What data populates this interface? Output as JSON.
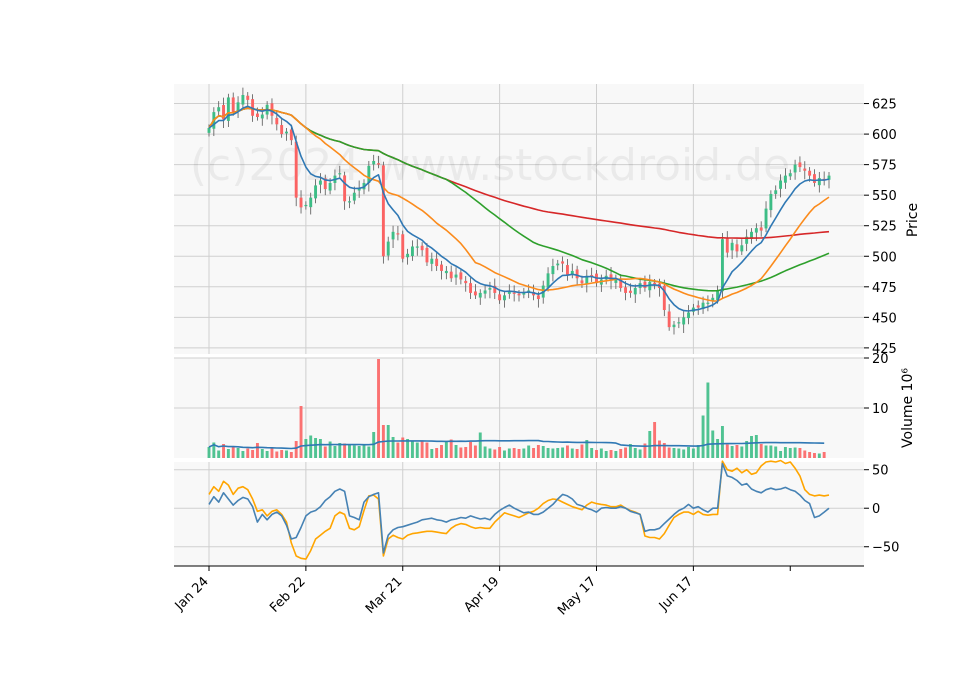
{
  "watermark": "(c)2024 www.stockdroid.de",
  "colors": {
    "up": "#3dbd86",
    "down": "#fb6363",
    "ma_fast": "#2f78b4",
    "ma_mid": "#fb8b1c",
    "ma_slow": "#2ea02c",
    "ma_long": "#d62728",
    "volume_ma": "#2f78b4",
    "osc_1": "#4682b4",
    "osc_2": "#ffa500"
  },
  "chart_data": {
    "type": "candlestick",
    "x_labels": [
      "Jan 24",
      "Feb 22",
      "Mar 21",
      "Apr 19",
      "May 17",
      "Jun 17"
    ],
    "x_label_index": [
      0,
      20,
      40,
      60,
      80,
      100
    ],
    "price_axis": {
      "label": "Price",
      "ticks": [
        425,
        450,
        475,
        500,
        525,
        550,
        575,
        600,
        625
      ],
      "range": [
        420,
        641
      ]
    },
    "volume_axis": {
      "label": "Volume  10⁶",
      "ticks": [
        10,
        20
      ],
      "range": [
        0,
        20
      ]
    },
    "osc_axis": {
      "ticks": [
        -50,
        0,
        50
      ],
      "range": [
        -75,
        60
      ]
    },
    "close": [
      605,
      618,
      622,
      612,
      630,
      618,
      626,
      632,
      628,
      615,
      614,
      616,
      624,
      615,
      608,
      600,
      602,
      595,
      548,
      540,
      542,
      548,
      558,
      562,
      555,
      560,
      566,
      568,
      545,
      545,
      552,
      556,
      560,
      574,
      578,
      575,
      500,
      512,
      520,
      518,
      498,
      502,
      508,
      508,
      505,
      495,
      498,
      492,
      488,
      488,
      482,
      485,
      481,
      478,
      470,
      468,
      470,
      472,
      474,
      470,
      464,
      468,
      472,
      470,
      468,
      470,
      472,
      468,
      465,
      476,
      486,
      492,
      494,
      494,
      485,
      488,
      482,
      478,
      484,
      484,
      478,
      481,
      484,
      480,
      482,
      474,
      470,
      470,
      474,
      478,
      474,
      479,
      477,
      474,
      456,
      442,
      444,
      446,
      450,
      454,
      458,
      458,
      462,
      462,
      466,
      472,
      514,
      503,
      511,
      504,
      509,
      516,
      520,
      523,
      521,
      539,
      551,
      554,
      562,
      566,
      568,
      575,
      573,
      570,
      566,
      560,
      564,
      562,
      566
    ],
    "volume": [
      2.2,
      3.1,
      1.5,
      2.8,
      1.8,
      2.3,
      2.0,
      1.4,
      1.9,
      1.6,
      3.0,
      1.8,
      1.4,
      1.9,
      1.3,
      1.6,
      1.5,
      1.2,
      3.4,
      10.4,
      3.8,
      4.5,
      4.0,
      3.8,
      2.3,
      3.3,
      2.4,
      3.0,
      2.9,
      2.6,
      2.5,
      2.4,
      2.5,
      2.3,
      5.2,
      19.8,
      6.6,
      6.6,
      4.2,
      3.1,
      4.1,
      3.8,
      3.3,
      3.1,
      3.5,
      3.1,
      1.8,
      2.0,
      2.6,
      3.2,
      3.7,
      2.6,
      2.1,
      2.2,
      3.2,
      2.5,
      5.1,
      2.3,
      1.9,
      1.7,
      2.2,
      1.5,
      1.9,
      2.0,
      1.8,
      1.9,
      2.5,
      2.0,
      2.6,
      2.4,
      2.0,
      1.9,
      2.0,
      2.1,
      2.5,
      1.9,
      1.8,
      2.7,
      3.6,
      2.0,
      1.6,
      1.9,
      1.4,
      1.6,
      1.4,
      1.8,
      2.1,
      2.8,
      2.0,
      1.7,
      2.9,
      5.4,
      7.2,
      3.5,
      3.0,
      2.1,
      2.0,
      1.9,
      1.7,
      2.2,
      1.9,
      2.6,
      8.5,
      15.1,
      5.5,
      3.8,
      6.4,
      2.7,
      2.4,
      2.6,
      2.3,
      3.4,
      4.4,
      4.6,
      2.8,
      2.5,
      2.5,
      2.3,
      1.4,
      2.2,
      2.0,
      2.1,
      2.0,
      1.5,
      1.2,
      1.0,
      0.9,
      1.2
    ],
    "osc_line_1": [
      5,
      15,
      8,
      20,
      12,
      4,
      10,
      14,
      12,
      2,
      -18,
      -8,
      -15,
      -8,
      -5,
      -10,
      -22,
      -40,
      -38,
      -25,
      -10,
      -5,
      -3,
      2,
      10,
      15,
      22,
      25,
      22,
      -10,
      -12,
      -15,
      8,
      15,
      18,
      20,
      -58,
      -35,
      -28,
      -25,
      -24,
      -22,
      -20,
      -18,
      -15,
      -14,
      -13,
      -15,
      -16,
      -18,
      -15,
      -14,
      -12,
      -13,
      -10,
      -12,
      -14,
      -13,
      -15,
      -8,
      -3,
      1,
      4,
      0,
      -3,
      -6,
      -5,
      -8,
      -8,
      -5,
      0,
      5,
      12,
      18,
      16,
      12,
      5,
      3,
      0,
      -2,
      -5,
      0,
      1,
      0,
      0,
      2,
      0,
      -4,
      -6,
      -8,
      -30,
      -28,
      -28,
      -26,
      -20,
      -14,
      -8,
      -3,
      0,
      5,
      0,
      2,
      -2,
      -5,
      0,
      0,
      58,
      42,
      40,
      36,
      30,
      32,
      25,
      22,
      20,
      24,
      26,
      24,
      25,
      27,
      24,
      22,
      17,
      10,
      6,
      -12,
      -10,
      -5,
      0
    ],
    "osc_line_2": [
      18,
      28,
      22,
      35,
      30,
      18,
      26,
      28,
      24,
      12,
      -4,
      -2,
      -10,
      -4,
      -2,
      -8,
      -18,
      -45,
      -62,
      -65,
      -66,
      -55,
      -40,
      -35,
      -30,
      -26,
      -10,
      -5,
      -8,
      -26,
      -28,
      -24,
      -3,
      16,
      17,
      12,
      -62,
      -40,
      -35,
      -38,
      -40,
      -35,
      -33,
      -32,
      -31,
      -30,
      -30,
      -31,
      -32,
      -33,
      -26,
      -22,
      -20,
      -21,
      -24,
      -26,
      -25,
      -26,
      -26,
      -18,
      -12,
      -6,
      -8,
      -10,
      -12,
      -9,
      -6,
      -4,
      0,
      6,
      10,
      12,
      11,
      8,
      5,
      2,
      0,
      -2,
      4,
      8,
      6,
      5,
      4,
      2,
      2,
      4,
      0,
      -3,
      -5,
      -8,
      -36,
      -38,
      -38,
      -40,
      -33,
      -22,
      -12,
      -8,
      -5,
      -5,
      -8,
      -4,
      -8,
      -9,
      -8,
      -8,
      61,
      50,
      48,
      52,
      46,
      50,
      44,
      46,
      55,
      60,
      61,
      60,
      62,
      58,
      60,
      52,
      42,
      24,
      18,
      16,
      17,
      16,
      17
    ]
  }
}
